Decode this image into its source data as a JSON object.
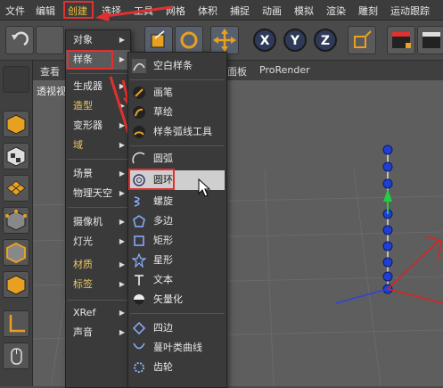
{
  "menubar": {
    "items": [
      "文件",
      "编辑",
      "创建",
      "选择",
      "工具",
      "网格",
      "体积",
      "捕捉",
      "动画",
      "模拟",
      "渲染",
      "雕刻",
      "运动跟踪"
    ]
  },
  "viewport": {
    "tabs": [
      "查看",
      "透视视图"
    ],
    "tab_right": [
      "面板",
      "ProRender"
    ]
  },
  "create_menu": {
    "items": [
      {
        "label": "对象",
        "sub": true
      },
      {
        "label": "样条",
        "sub": true,
        "active": true
      },
      {
        "label": "生成器",
        "sub": true
      },
      {
        "label": "造型",
        "sub": true,
        "gold": true
      },
      {
        "label": "变形器",
        "sub": true
      },
      {
        "label": "域",
        "sub": true,
        "gold": true
      },
      {
        "label": "场景",
        "sub": true
      },
      {
        "label": "物理天空",
        "sub": true
      },
      {
        "label": "摄像机",
        "sub": true
      },
      {
        "label": "灯光",
        "sub": true
      },
      {
        "label": "材质",
        "sub": true,
        "gold": true
      },
      {
        "label": "标签",
        "sub": true,
        "gold": true
      },
      {
        "label": "XRef",
        "sub": true
      },
      {
        "label": "声音",
        "sub": true
      }
    ]
  },
  "spline_menu": {
    "items": [
      {
        "label": "空白样条",
        "icon": "empty-spline-icon"
      },
      {
        "label": "画笔",
        "icon": "pen-icon"
      },
      {
        "label": "草绘",
        "icon": "sketch-icon"
      },
      {
        "label": "样条弧线工具",
        "icon": "spline-arc-tool-icon"
      },
      {
        "label": "圆弧",
        "icon": "arc-icon"
      },
      {
        "label": "圆环",
        "icon": "circle-icon",
        "hover": true
      },
      {
        "label": "螺旋",
        "icon": "helix-icon"
      },
      {
        "label": "多边",
        "icon": "polygon-icon"
      },
      {
        "label": "矩形",
        "icon": "rectangle-icon"
      },
      {
        "label": "星形",
        "icon": "star-icon"
      },
      {
        "label": "文本",
        "icon": "text-icon"
      },
      {
        "label": "矢量化",
        "icon": "vectorizer-icon"
      },
      {
        "label": "四边",
        "icon": "four-side-icon"
      },
      {
        "label": "蔓叶类曲线",
        "icon": "cissoid-icon"
      },
      {
        "label": "齿轮",
        "icon": "cogwheel-icon"
      }
    ]
  },
  "colors": {
    "highlight_red": "#e23030",
    "menu_bg": "#3a3a3a",
    "hover_bg": "#cfcfcf",
    "gold_text": "#f0c860",
    "axis_blue": "#2e3a57"
  }
}
